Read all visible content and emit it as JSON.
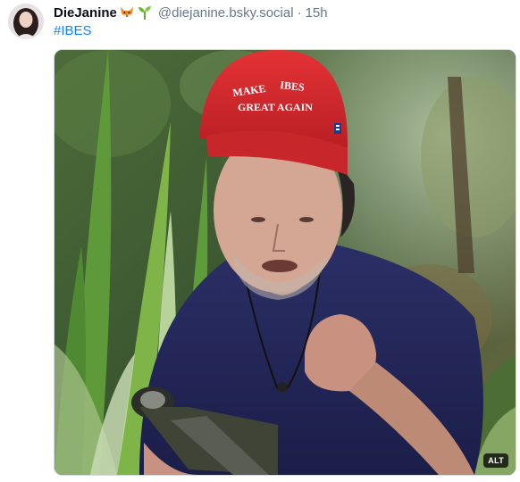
{
  "post": {
    "author": {
      "display_name": "DieJanine",
      "handle": "@diejanine.bsky.social",
      "emoji_1": "fox-face-icon",
      "emoji_2": "seedling-icon"
    },
    "separator": "·",
    "timestamp": "15h",
    "hashtag": "#IBES",
    "media": {
      "alt_badge": "ALT",
      "cap_text": {
        "line_1a": "MAKE",
        "line_1b": "IBES",
        "line_2": "GREAT AGAIN"
      }
    }
  },
  "colors": {
    "link": "#1083fe",
    "muted": "#66788a",
    "cap_red": "#d42a2e"
  }
}
